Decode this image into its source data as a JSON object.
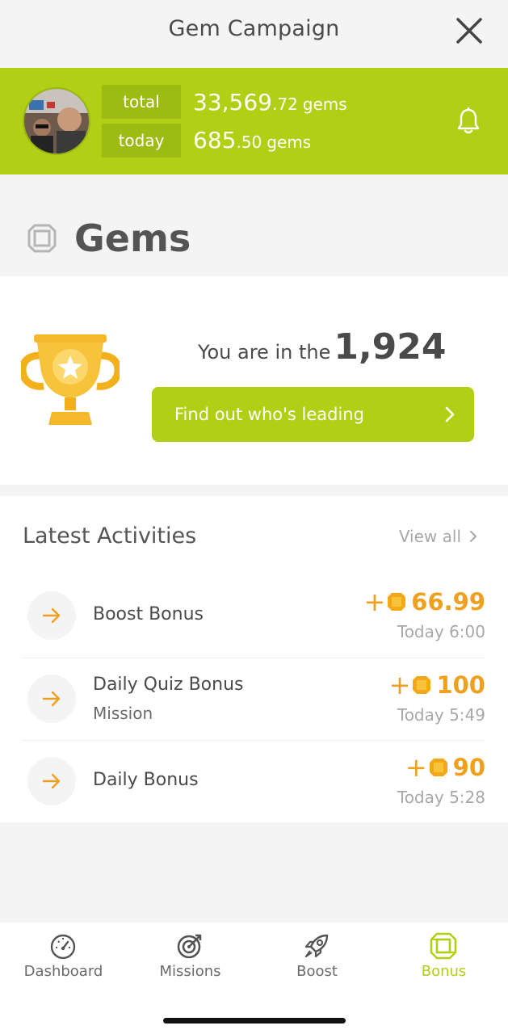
{
  "header": {
    "title": "Gem Campaign",
    "close_icon": "close-icon"
  },
  "banner": {
    "total_label": "total",
    "total_int": "33,569",
    "total_dec": ".72",
    "today_label": "today",
    "today_int": "685",
    "today_dec": ".50",
    "unit": "gems",
    "bell_icon": "bell-icon",
    "color": "#b0cf15"
  },
  "gems_section": {
    "title": "Gems",
    "icon": "gem-icon"
  },
  "ranking": {
    "prefix": "You are in the",
    "rank": "1,924",
    "button_label": "Find out who's leading",
    "trophy_icon": "trophy-icon"
  },
  "activities": {
    "title": "Latest Activities",
    "view_all": "View all",
    "items": [
      {
        "name": "Boost Bonus",
        "sub": "",
        "plus": "+",
        "amount": "66.99",
        "time": "Today 6:00"
      },
      {
        "name": "Daily Quiz Bonus",
        "sub": "Mission",
        "plus": "+",
        "amount": "100",
        "time": "Today 5:49"
      },
      {
        "name": "Daily Bonus",
        "sub": "",
        "plus": "+",
        "amount": "90",
        "time": "Today 5:28"
      }
    ],
    "amount_color": "#efa020"
  },
  "tabs": [
    {
      "label": "Dashboard",
      "icon": "dashboard-icon",
      "active": false
    },
    {
      "label": "Missions",
      "icon": "target-icon",
      "active": false
    },
    {
      "label": "Boost",
      "icon": "rocket-icon",
      "active": false
    },
    {
      "label": "Bonus",
      "icon": "gem-icon",
      "active": true
    }
  ]
}
